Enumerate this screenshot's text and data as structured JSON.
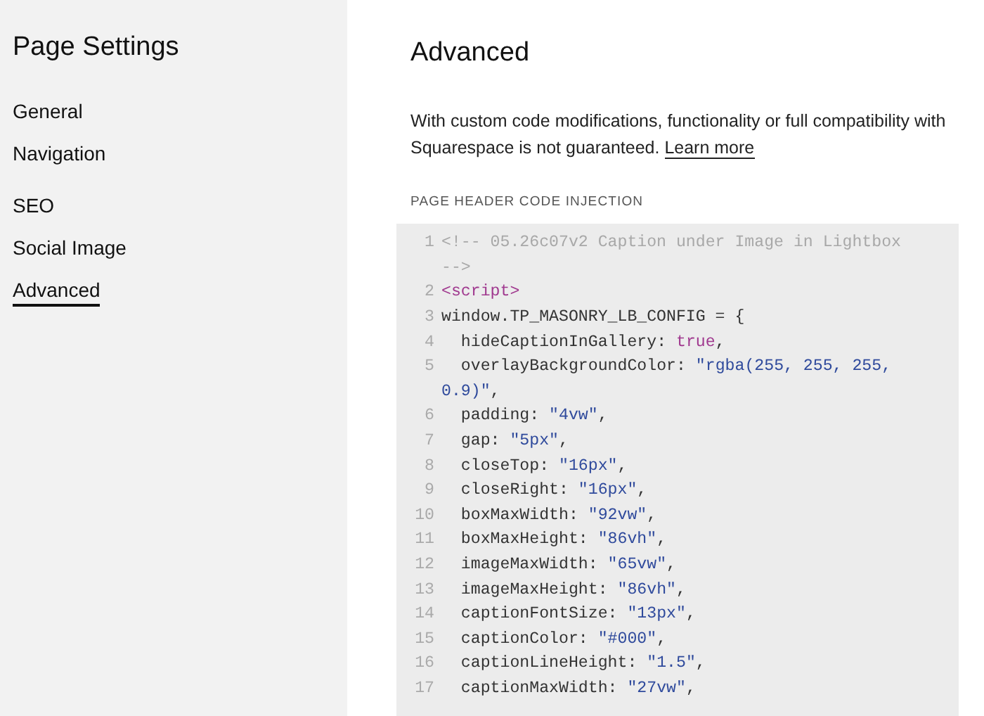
{
  "sidebar": {
    "title": "Page Settings",
    "groups": [
      [
        {
          "label": "General",
          "selected": false
        },
        {
          "label": "Navigation",
          "selected": false
        }
      ],
      [
        {
          "label": "SEO",
          "selected": false
        },
        {
          "label": "Social Image",
          "selected": false
        },
        {
          "label": "Advanced",
          "selected": true
        }
      ]
    ]
  },
  "main": {
    "title": "Advanced",
    "description": {
      "text": "With custom code modifications, functionality or full compatibility with Squarespace is not guaranteed.",
      "link": "Learn more"
    },
    "section_label": "PAGE HEADER CODE INJECTION",
    "code_editor": {
      "lines": [
        {
          "number": "1",
          "tokens": [
            {
              "kind": "comment",
              "text": "<!-- 05.26c07v2 Caption under Image in Lightbox -->"
            }
          ]
        },
        {
          "number": "2",
          "tokens": [
            {
              "kind": "tag",
              "text": "<script>"
            }
          ]
        },
        {
          "number": "3",
          "tokens": [
            {
              "kind": "plain",
              "text": "window.TP_MASONRY_LB_CONFIG = {"
            }
          ]
        },
        {
          "number": "4",
          "tokens": [
            {
              "kind": "plain",
              "text": "  hideCaptionInGallery: "
            },
            {
              "kind": "keyword",
              "text": "true"
            },
            {
              "kind": "plain",
              "text": ","
            }
          ]
        },
        {
          "number": "5",
          "tokens": [
            {
              "kind": "plain",
              "text": "  overlayBackgroundColor: "
            },
            {
              "kind": "string",
              "text": "\"rgba(255, 255, 255, 0.9)\""
            },
            {
              "kind": "plain",
              "text": ","
            }
          ]
        },
        {
          "number": "6",
          "tokens": [
            {
              "kind": "plain",
              "text": "  padding: "
            },
            {
              "kind": "string",
              "text": "\"4vw\""
            },
            {
              "kind": "plain",
              "text": ","
            }
          ]
        },
        {
          "number": "7",
          "tokens": [
            {
              "kind": "plain",
              "text": "  gap: "
            },
            {
              "kind": "string",
              "text": "\"5px\""
            },
            {
              "kind": "plain",
              "text": ","
            }
          ]
        },
        {
          "number": "8",
          "tokens": [
            {
              "kind": "plain",
              "text": "  closeTop: "
            },
            {
              "kind": "string",
              "text": "\"16px\""
            },
            {
              "kind": "plain",
              "text": ","
            }
          ]
        },
        {
          "number": "9",
          "tokens": [
            {
              "kind": "plain",
              "text": "  closeRight: "
            },
            {
              "kind": "string",
              "text": "\"16px\""
            },
            {
              "kind": "plain",
              "text": ","
            }
          ]
        },
        {
          "number": "10",
          "tokens": [
            {
              "kind": "plain",
              "text": "  boxMaxWidth: "
            },
            {
              "kind": "string",
              "text": "\"92vw\""
            },
            {
              "kind": "plain",
              "text": ","
            }
          ]
        },
        {
          "number": "11",
          "tokens": [
            {
              "kind": "plain",
              "text": "  boxMaxHeight: "
            },
            {
              "kind": "string",
              "text": "\"86vh\""
            },
            {
              "kind": "plain",
              "text": ","
            }
          ]
        },
        {
          "number": "12",
          "tokens": [
            {
              "kind": "plain",
              "text": "  imageMaxWidth: "
            },
            {
              "kind": "string",
              "text": "\"65vw\""
            },
            {
              "kind": "plain",
              "text": ","
            }
          ]
        },
        {
          "number": "13",
          "tokens": [
            {
              "kind": "plain",
              "text": "  imageMaxHeight: "
            },
            {
              "kind": "string",
              "text": "\"86vh\""
            },
            {
              "kind": "plain",
              "text": ","
            }
          ]
        },
        {
          "number": "14",
          "tokens": [
            {
              "kind": "plain",
              "text": "  captionFontSize: "
            },
            {
              "kind": "string",
              "text": "\"13px\""
            },
            {
              "kind": "plain",
              "text": ","
            }
          ]
        },
        {
          "number": "15",
          "tokens": [
            {
              "kind": "plain",
              "text": "  captionColor: "
            },
            {
              "kind": "string",
              "text": "\"#000\""
            },
            {
              "kind": "plain",
              "text": ","
            }
          ]
        },
        {
          "number": "16",
          "tokens": [
            {
              "kind": "plain",
              "text": "  captionLineHeight: "
            },
            {
              "kind": "string",
              "text": "\"1.5\""
            },
            {
              "kind": "plain",
              "text": ","
            }
          ]
        },
        {
          "number": "17",
          "tokens": [
            {
              "kind": "plain",
              "text": "  captionMaxWidth: "
            },
            {
              "kind": "string",
              "text": "\"27vw\""
            },
            {
              "kind": "plain",
              "text": ","
            }
          ]
        }
      ]
    }
  }
}
